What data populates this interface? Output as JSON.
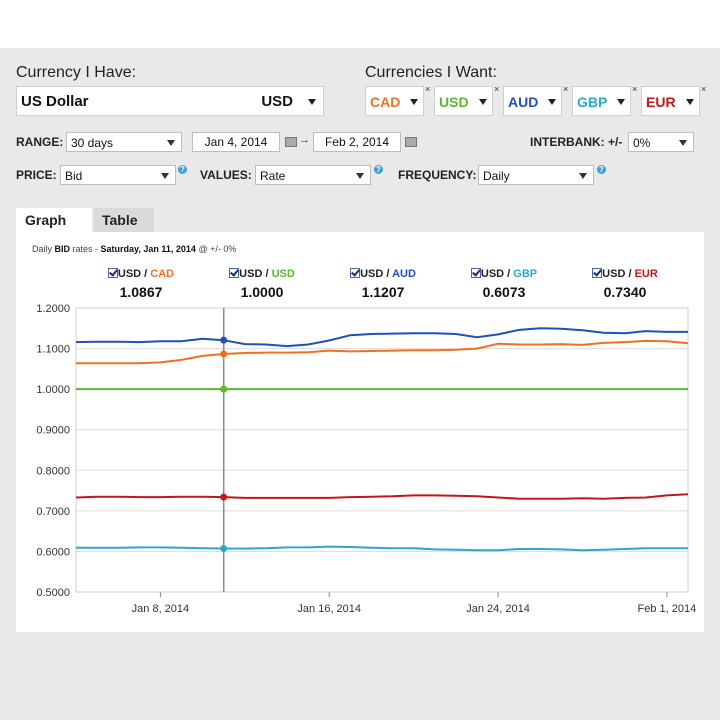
{
  "have": {
    "label": "Currency I Have:",
    "name": "US Dollar",
    "code": "USD"
  },
  "want": {
    "label": "Currencies I Want:",
    "close_glyph": "×",
    "items": [
      {
        "code": "CAD",
        "color": "#f07020"
      },
      {
        "code": "USD",
        "color": "#5ab92a"
      },
      {
        "code": "AUD",
        "color": "#1f4fc0"
      },
      {
        "code": "GBP",
        "color": "#2ca8cf"
      },
      {
        "code": "EUR",
        "color": "#c01818"
      }
    ]
  },
  "controls": {
    "range_label": "RANGE:",
    "range_value": "30 days",
    "date_from": "Jan 4, 2014",
    "date_sep": "→",
    "date_to": "Feb 2, 2014",
    "interbank_label": "INTERBANK: +/-",
    "interbank_value": "0%",
    "price_label": "PRICE:",
    "price_value": "Bid",
    "values_label": "VALUES:",
    "values_value": "Rate",
    "frequency_label": "FREQUENCY:",
    "frequency_value": "Daily",
    "help_glyph": "?"
  },
  "tabs": [
    "Graph",
    "Table"
  ],
  "caption": {
    "prefix": "Daily ",
    "bold": "BID",
    "mid": " rates - ",
    "date": "Saturday, Jan 11, 2014",
    "suffix": " @ +/- 0%"
  },
  "legend": [
    {
      "base": "USD",
      "sep": " / ",
      "quote": "CAD",
      "value": "1.0867",
      "color": "#f07020"
    },
    {
      "base": "USD",
      "sep": " / ",
      "quote": "USD",
      "value": "1.0000",
      "color": "#5ab92a"
    },
    {
      "base": "USD",
      "sep": " / ",
      "quote": "AUD",
      "value": "1.1207",
      "color": "#1f4fc0"
    },
    {
      "base": "USD",
      "sep": " / ",
      "quote": "GBP",
      "value": "0.6073",
      "color": "#2ca8cf"
    },
    {
      "base": "USD",
      "sep": " / ",
      "quote": "EUR",
      "value": "0.7340",
      "color": "#c01818"
    }
  ],
  "chart_data": {
    "type": "line",
    "x_start": "2014-01-04",
    "x": [
      "2014-01-04",
      "2014-01-05",
      "2014-01-06",
      "2014-01-07",
      "2014-01-08",
      "2014-01-09",
      "2014-01-10",
      "2014-01-11",
      "2014-01-12",
      "2014-01-13",
      "2014-01-14",
      "2014-01-15",
      "2014-01-16",
      "2014-01-17",
      "2014-01-18",
      "2014-01-19",
      "2014-01-20",
      "2014-01-21",
      "2014-01-22",
      "2014-01-23",
      "2014-01-24",
      "2014-01-25",
      "2014-01-26",
      "2014-01-27",
      "2014-01-28",
      "2014-01-29",
      "2014-01-30",
      "2014-01-31",
      "2014-02-01",
      "2014-02-02"
    ],
    "xticks": [
      {
        "label": "Jan 8, 2014",
        "date": "2014-01-08"
      },
      {
        "label": "Jan 16, 2014",
        "date": "2014-01-16"
      },
      {
        "label": "Jan 24, 2014",
        "date": "2014-01-24"
      },
      {
        "label": "Feb 1, 2014",
        "date": "2014-02-01"
      }
    ],
    "yticks": [
      "1.2000",
      "1.1000",
      "1.0000",
      "0.9000",
      "0.8000",
      "0.7000",
      "0.6000",
      "0.5000"
    ],
    "ylim": [
      0.5,
      1.2
    ],
    "highlight_date": "2014-01-11",
    "grid": true,
    "series": [
      {
        "name": "USD / CAD",
        "color": "#f07020",
        "values": [
          1.064,
          1.064,
          1.064,
          1.064,
          1.066,
          1.072,
          1.082,
          1.0867,
          1.089,
          1.09,
          1.09,
          1.091,
          1.095,
          1.093,
          1.094,
          1.095,
          1.096,
          1.096,
          1.097,
          1.1,
          1.112,
          1.11,
          1.11,
          1.111,
          1.109,
          1.114,
          1.116,
          1.119,
          1.118,
          1.113
        ]
      },
      {
        "name": "USD / USD",
        "color": "#5ab92a",
        "values": [
          1.0,
          1.0,
          1.0,
          1.0,
          1.0,
          1.0,
          1.0,
          1.0,
          1.0,
          1.0,
          1.0,
          1.0,
          1.0,
          1.0,
          1.0,
          1.0,
          1.0,
          1.0,
          1.0,
          1.0,
          1.0,
          1.0,
          1.0,
          1.0,
          1.0,
          1.0,
          1.0,
          1.0,
          1.0,
          1.0
        ]
      },
      {
        "name": "USD / AUD",
        "color": "#1f4fc0",
        "values": [
          1.116,
          1.117,
          1.117,
          1.116,
          1.118,
          1.118,
          1.124,
          1.1207,
          1.111,
          1.11,
          1.106,
          1.11,
          1.12,
          1.133,
          1.136,
          1.137,
          1.138,
          1.138,
          1.136,
          1.128,
          1.135,
          1.146,
          1.15,
          1.149,
          1.145,
          1.139,
          1.138,
          1.143,
          1.141,
          1.141
        ]
      },
      {
        "name": "USD / GBP",
        "color": "#2ca8cf",
        "values": [
          0.609,
          0.609,
          0.609,
          0.61,
          0.61,
          0.609,
          0.608,
          0.6073,
          0.607,
          0.608,
          0.61,
          0.61,
          0.612,
          0.611,
          0.609,
          0.608,
          0.608,
          0.605,
          0.604,
          0.603,
          0.603,
          0.606,
          0.606,
          0.605,
          0.603,
          0.604,
          0.606,
          0.608,
          0.608,
          0.608
        ]
      },
      {
        "name": "USD / EUR",
        "color": "#c01818",
        "values": [
          0.733,
          0.735,
          0.735,
          0.734,
          0.734,
          0.735,
          0.735,
          0.734,
          0.732,
          0.732,
          0.732,
          0.732,
          0.732,
          0.734,
          0.735,
          0.736,
          0.738,
          0.738,
          0.737,
          0.736,
          0.733,
          0.73,
          0.73,
          0.73,
          0.731,
          0.73,
          0.732,
          0.733,
          0.738,
          0.741
        ]
      }
    ]
  }
}
